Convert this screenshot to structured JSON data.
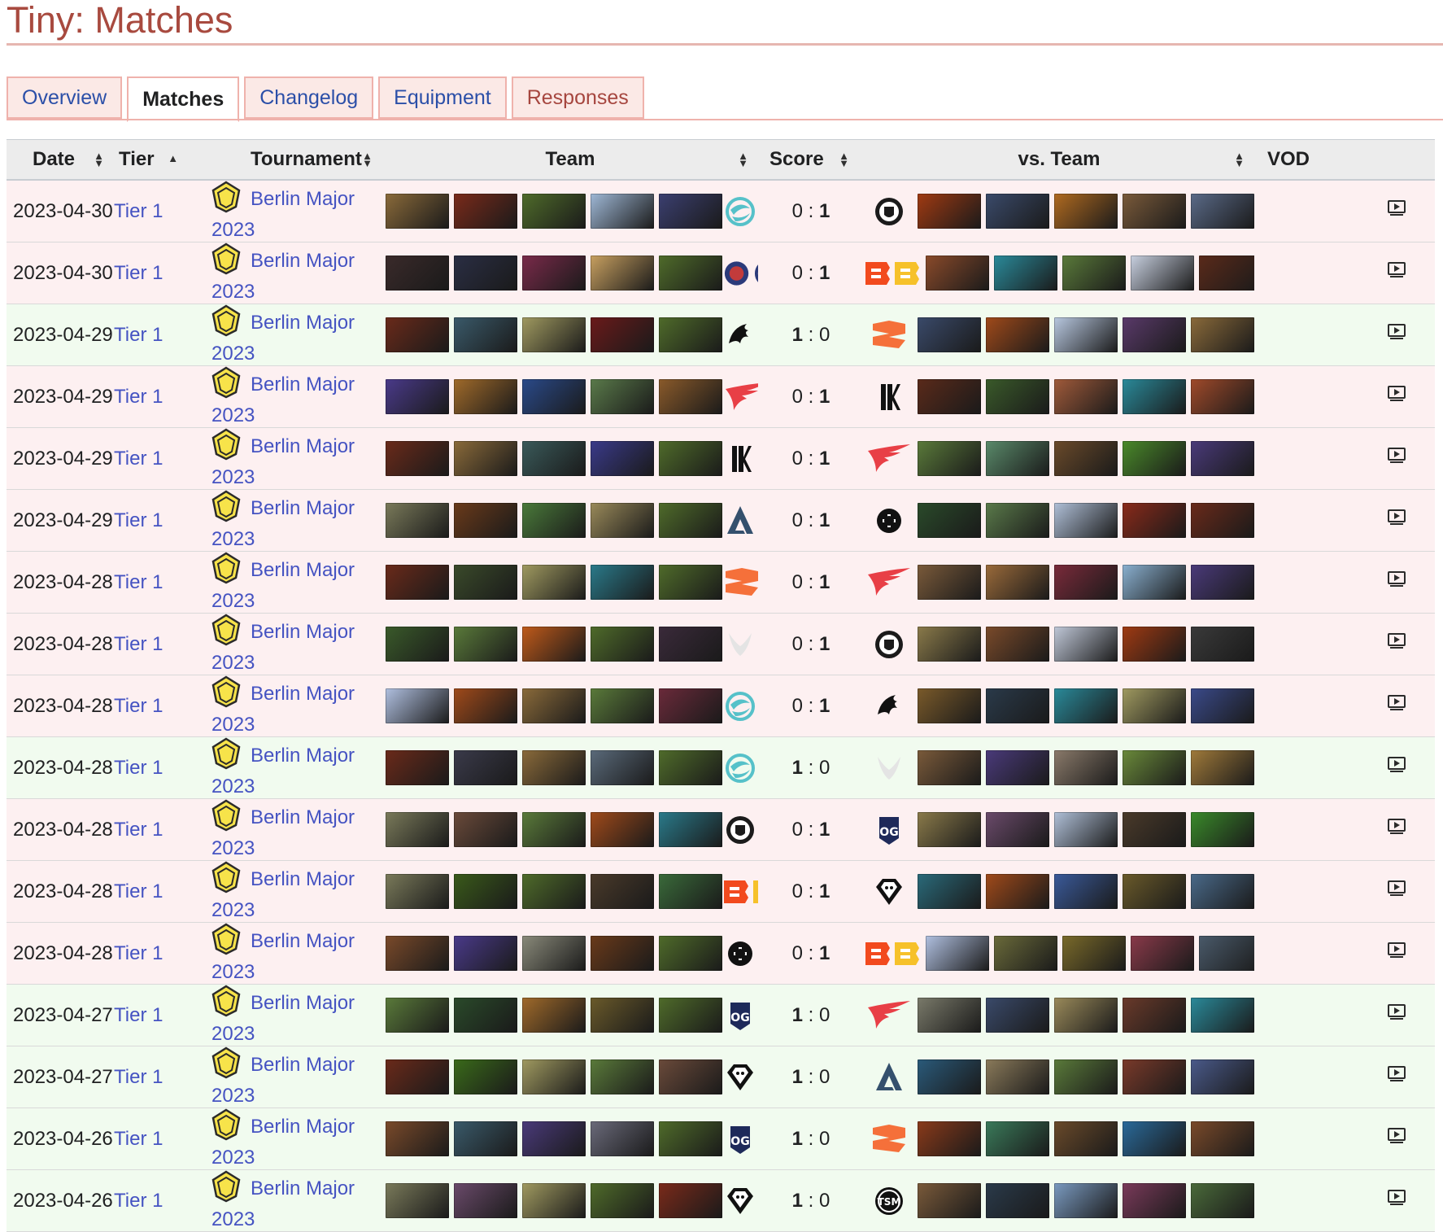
{
  "page": {
    "title": "Tiny: Matches"
  },
  "tabs": [
    {
      "label": "Overview",
      "active": false
    },
    {
      "label": "Matches",
      "active": true
    },
    {
      "label": "Changelog",
      "active": false
    },
    {
      "label": "Equipment",
      "active": false
    },
    {
      "label": "Responses",
      "active": false
    }
  ],
  "table": {
    "headers": {
      "date": "Date",
      "tier": "Tier",
      "tournament": "Tournament",
      "team": "Team",
      "score": "Score",
      "vs_team": "vs. Team",
      "vod": "VOD"
    },
    "colors": {
      "loss_row": "#fdf0f1",
      "win_row": "#f1fbef",
      "link": "#4553c2"
    },
    "rows": [
      {
        "date": "2023-04-30",
        "tier": "Tier 1",
        "tournament": "Berlin Major 2023",
        "team": "team-aqua-icon",
        "score_l": "0",
        "score_r": "1",
        "vs": "team-dark-shield-icon",
        "result": "loss",
        "heroes_l": [
          "#8a6a3a",
          "#7a2a1a",
          "#4f6b2a",
          "#9fb8d6",
          "#3b3f70"
        ],
        "heroes_r": [
          "#a03a12",
          "#3a4a6a",
          "#b06a20",
          "#7a5a3a",
          "#5a6a88"
        ]
      },
      {
        "date": "2023-04-30",
        "tier": "Tier 1",
        "tournament": "Berlin Major 2023",
        "team": "team-pair-blue-icon",
        "score_l": "0",
        "score_r": "1",
        "vs": "team-orange-bb-icon",
        "result": "loss",
        "heroes_l": [
          "#3a2a2a",
          "#2a2e44",
          "#7a2a4a",
          "#c8a060",
          "#4f6b2a"
        ],
        "heroes_r": [
          "#8a4a2a",
          "#2a8a9a",
          "#5a7a3a",
          "#c8d0e0",
          "#5a2a1a"
        ]
      },
      {
        "date": "2023-04-29",
        "tier": "Tier 1",
        "tournament": "Berlin Major 2023",
        "team": "team-black-dragon-icon",
        "score_l": "1",
        "score_r": "0",
        "vs": "team-orange-s-icon",
        "result": "win",
        "heroes_l": [
          "#6a2a1a",
          "#3a5a6a",
          "#a09a60",
          "#6a1a1a",
          "#4f6b2a"
        ],
        "heroes_r": [
          "#3a4a6a",
          "#a04a1a",
          "#b8c8e0",
          "#5a3a6a",
          "#8a6a3a"
        ]
      },
      {
        "date": "2023-04-29",
        "tier": "Tier 1",
        "tournament": "Berlin Major 2023",
        "team": "team-red-wing-icon",
        "score_l": "0",
        "score_r": "1",
        "vs": "team-black-k-icon",
        "result": "loss",
        "heroes_l": [
          "#4a3a8a",
          "#a06a2a",
          "#2a4a8a",
          "#5a7a4a",
          "#8a5a2a"
        ],
        "heroes_r": [
          "#5a2a1a",
          "#3a5a2a",
          "#a05a3a",
          "#2a8a9a",
          "#a04a2a"
        ]
      },
      {
        "date": "2023-04-29",
        "tier": "Tier 1",
        "tournament": "Berlin Major 2023",
        "team": "team-black-k-icon",
        "score_l": "0",
        "score_r": "1",
        "vs": "team-red-wing-icon",
        "result": "loss",
        "heroes_l": [
          "#6a2a1a",
          "#8a6a3a",
          "#3a5a5a",
          "#3a3a8a",
          "#4f6b2a"
        ],
        "heroes_r": [
          "#5a7a3a",
          "#5a8a6a",
          "#6a4a2a",
          "#4a8a2a",
          "#4a3a7a"
        ]
      },
      {
        "date": "2023-04-29",
        "tier": "Tier 1",
        "tournament": "Berlin Major 2023",
        "team": "team-steel-a-icon",
        "score_l": "0",
        "score_r": "1",
        "vs": "team-black-eg-icon",
        "result": "loss",
        "heroes_l": [
          "#7a7a5a",
          "#6a3a1a",
          "#4a7a3a",
          "#9a8a5a",
          "#4f6b2a"
        ],
        "heroes_r": [
          "#2a4a2a",
          "#5a7a4a",
          "#b0c0d8",
          "#8a2a1a",
          "#6a2a1a"
        ]
      },
      {
        "date": "2023-04-28",
        "tier": "Tier 1",
        "tournament": "Berlin Major 2023",
        "team": "team-orange-s-icon",
        "score_l": "0",
        "score_r": "1",
        "vs": "team-red-wing-icon",
        "result": "loss",
        "heroes_l": [
          "#6a2a1a",
          "#3a4a2a",
          "#a09a60",
          "#2a7a8a",
          "#4f6b2a"
        ],
        "heroes_r": [
          "#7a5a3a",
          "#9a6a3a",
          "#7a2a3a",
          "#8ab0d0",
          "#4a3a7a"
        ]
      },
      {
        "date": "2023-04-28",
        "tier": "Tier 1",
        "tournament": "Berlin Major 2023",
        "team": "team-white-wings-icon",
        "score_l": "0",
        "score_r": "1",
        "vs": "team-dark-shield-icon",
        "result": "loss",
        "heroes_l": [
          "#3a5a2a",
          "#5a7a3a",
          "#c05a1a",
          "#4f6b2a",
          "#3a2a3a"
        ],
        "heroes_r": [
          "#8a7a4a",
          "#7a4a2a",
          "#c0c8d8",
          "#a03a12",
          "#3a3a3a"
        ]
      },
      {
        "date": "2023-04-28",
        "tier": "Tier 1",
        "tournament": "Berlin Major 2023",
        "team": "team-aqua-icon",
        "score_l": "0",
        "score_r": "1",
        "vs": "team-black-dragon-icon",
        "result": "loss",
        "heroes_l": [
          "#b0c0e0",
          "#a04a1a",
          "#8a6a3a",
          "#5a7a3a",
          "#6a2a3a"
        ],
        "heroes_r": [
          "#7a5a2a",
          "#2a3a4a",
          "#2a8a9a",
          "#a09a60",
          "#3a4a8a"
        ]
      },
      {
        "date": "2023-04-28",
        "tier": "Tier 1",
        "tournament": "Berlin Major 2023",
        "team": "team-aqua-icon",
        "score_l": "1",
        "score_r": "0",
        "vs": "team-white-wings-icon",
        "result": "win",
        "heroes_l": [
          "#6a2a1a",
          "#3a3a4a",
          "#8a6a3a",
          "#5a6a7a",
          "#4f6b2a"
        ],
        "heroes_r": [
          "#7a5a3a",
          "#4a3a7a",
          "#8a7a6a",
          "#6a8a3a",
          "#a07a3a"
        ]
      },
      {
        "date": "2023-04-28",
        "tier": "Tier 1",
        "tournament": "Berlin Major 2023",
        "team": "team-dark-shield-icon",
        "score_l": "0",
        "score_r": "1",
        "vs": "team-og-icon",
        "result": "loss",
        "heroes_l": [
          "#7a7a5a",
          "#6a4a3a",
          "#5a7a3a",
          "#a04a1a",
          "#2a7a8a"
        ],
        "heroes_r": [
          "#8a7a4a",
          "#6a4a6a",
          "#b0c0d8",
          "#4a3a2a",
          "#3a8a2a"
        ]
      },
      {
        "date": "2023-04-28",
        "tier": "Tier 1",
        "tournament": "Berlin Major 2023",
        "team": "team-orange-bb-icon",
        "score_l": "0",
        "score_r": "1",
        "vs": "team-diamond-icon",
        "result": "loss",
        "heroes_l": [
          "#7a7a5a",
          "#3a5a1a",
          "#4f6b2a",
          "#4a3a2a",
          "#3a6a3a"
        ],
        "heroes_r": [
          "#2a6a7a",
          "#a04a1a",
          "#3a5a9a",
          "#6a5a2a",
          "#4a6a8a"
        ]
      },
      {
        "date": "2023-04-28",
        "tier": "Tier 1",
        "tournament": "Berlin Major 2023",
        "team": "team-black-eg-icon",
        "score_l": "0",
        "score_r": "1",
        "vs": "team-orange-bb-icon",
        "result": "loss",
        "heroes_l": [
          "#7a4a2a",
          "#4a3a8a",
          "#8a8a7a",
          "#6a3a1a",
          "#4f6b2a"
        ],
        "heroes_r": [
          "#b0c0e0",
          "#6a6a3a",
          "#7a6a2a",
          "#8a3a4a",
          "#4a5a6a"
        ]
      },
      {
        "date": "2023-04-27",
        "tier": "Tier 1",
        "tournament": "Berlin Major 2023",
        "team": "team-og-icon",
        "score_l": "1",
        "score_r": "0",
        "vs": "team-red-wing-icon",
        "result": "win",
        "heroes_l": [
          "#5a7a3a",
          "#2a4a2a",
          "#a06a2a",
          "#6a5a2a",
          "#4f6b2a"
        ],
        "heroes_r": [
          "#7a7a6a",
          "#3a4a6a",
          "#9a8a5a",
          "#6a3a2a",
          "#2a8a9a"
        ]
      },
      {
        "date": "2023-04-27",
        "tier": "Tier 1",
        "tournament": "Berlin Major 2023",
        "team": "team-diamond-icon",
        "score_l": "1",
        "score_r": "0",
        "vs": "team-steel-a-icon",
        "result": "win",
        "heroes_l": [
          "#6a2a1a",
          "#3a6a1a",
          "#a09a60",
          "#5a7a3a",
          "#6a4a3a"
        ],
        "heroes_r": [
          "#2a5a7a",
          "#8a7a5a",
          "#5a7a3a",
          "#7a3a2a",
          "#4a5a8a"
        ]
      },
      {
        "date": "2023-04-26",
        "tier": "Tier 1",
        "tournament": "Berlin Major 2023",
        "team": "team-og-icon",
        "score_l": "1",
        "score_r": "0",
        "vs": "team-orange-s-icon",
        "result": "win",
        "heroes_l": [
          "#7a4a2a",
          "#3a5a6a",
          "#4a3a7a",
          "#6a6a7a",
          "#4f6b2a"
        ],
        "heroes_r": [
          "#8a3a1a",
          "#3a7a5a",
          "#6a4a2a",
          "#2a6a9a",
          "#7a4a2a"
        ]
      },
      {
        "date": "2023-04-26",
        "tier": "Tier 1",
        "tournament": "Berlin Major 2023",
        "team": "team-diamond-icon",
        "score_l": "1",
        "score_r": "0",
        "vs": "team-tsm-icon",
        "result": "win",
        "heroes_l": [
          "#7a7a5a",
          "#6a4a6a",
          "#a09a60",
          "#4f6b2a",
          "#7a2a1a"
        ],
        "heroes_r": [
          "#7a5a3a",
          "#2a3a4a",
          "#7a9ac0",
          "#7a3a5a",
          "#4a6a3a"
        ]
      }
    ]
  }
}
